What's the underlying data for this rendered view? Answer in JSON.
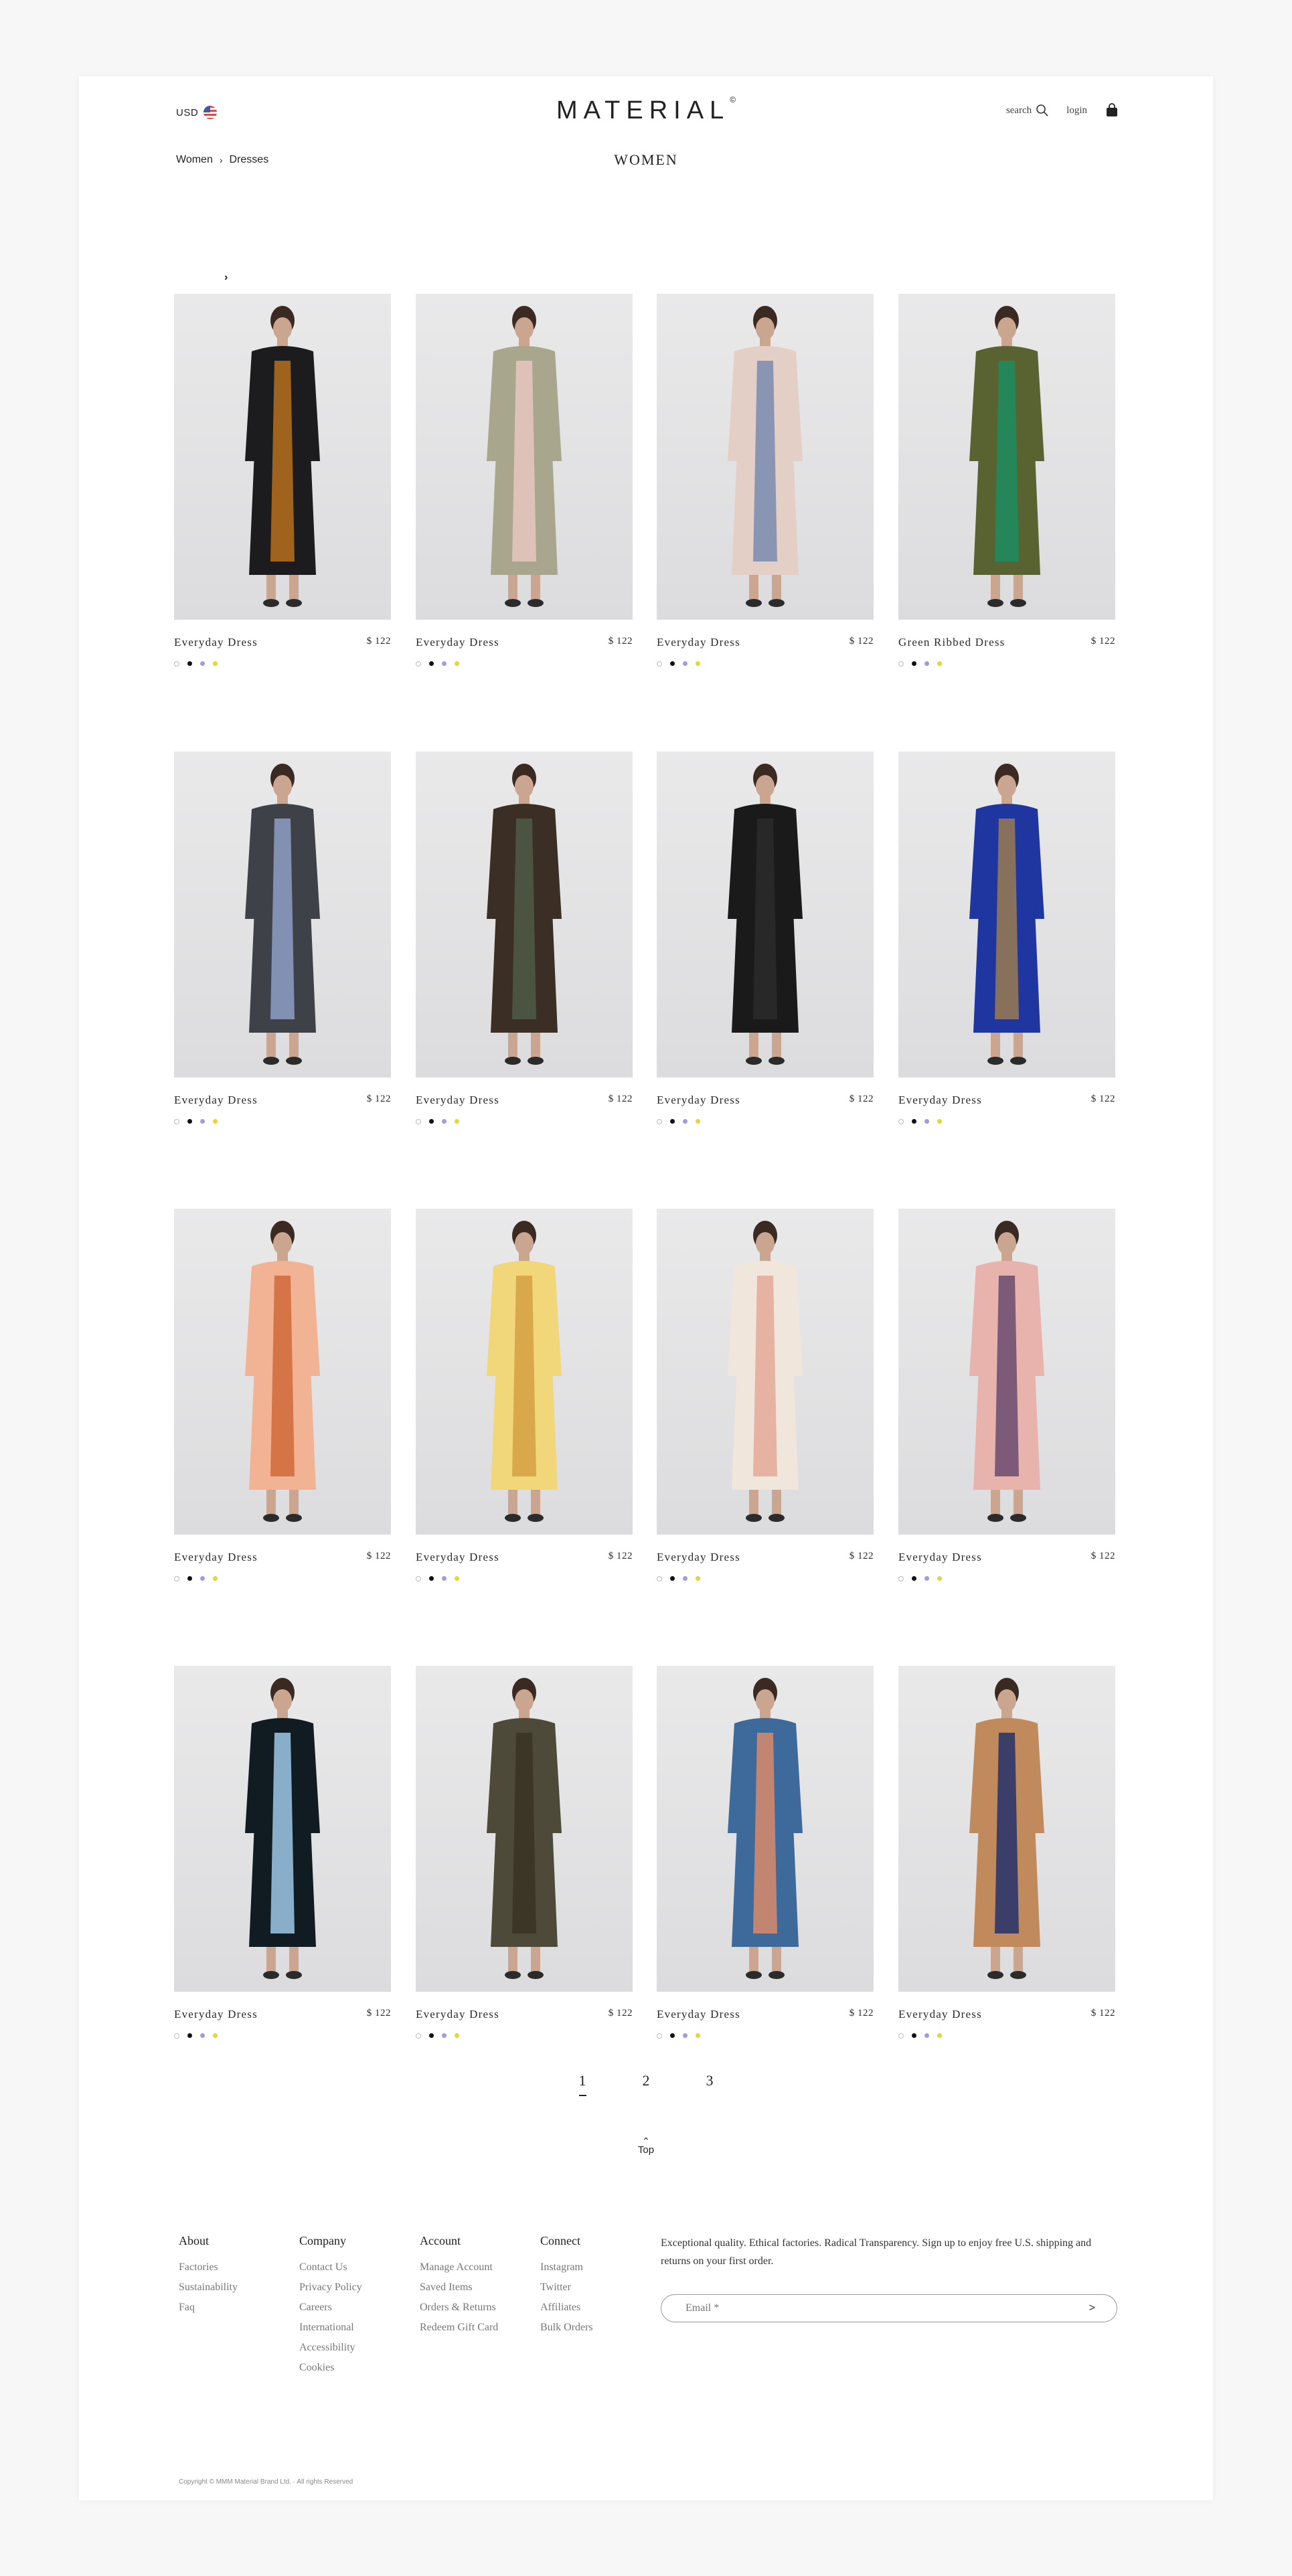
{
  "header": {
    "currency": "USD",
    "logo": "MATERIAL",
    "logo_mark": "©",
    "search_label": "search",
    "login_label": "login"
  },
  "breadcrumb": {
    "items": [
      "Women",
      "Dresses"
    ],
    "separator": "›"
  },
  "section_title": "WOMEN",
  "filter_chevron": "›",
  "products": [
    {
      "name": "Everyday Dress",
      "price": "$ 122",
      "outfit": "#1c1c1e",
      "accent": "#b7701d"
    },
    {
      "name": "Everyday Dress",
      "price": "$ 122",
      "outfit": "#a8a68c",
      "accent": "#e7c7c0"
    },
    {
      "name": "Everyday Dress",
      "price": "$ 122",
      "outfit": "#e4cfc7",
      "accent": "#7a8bb0"
    },
    {
      "name": "Green Ribbed Dress",
      "price": "$ 122",
      "outfit": "#596331",
      "accent": "#1c8c62"
    },
    {
      "name": "Everyday Dress",
      "price": "$ 122",
      "outfit": "#3e4148",
      "accent": "#8ea0c7"
    },
    {
      "name": "Everyday Dress",
      "price": "$ 122",
      "outfit": "#3b2f25",
      "accent": "#4f5a45"
    },
    {
      "name": "Everyday Dress",
      "price": "$ 122",
      "outfit": "#1a1a1a",
      "accent": "#2b2b2b"
    },
    {
      "name": "Everyday Dress",
      "price": "$ 122",
      "outfit": "#1f35a0",
      "accent": "#9a7a50"
    },
    {
      "name": "Everyday Dress",
      "price": "$ 122",
      "outfit": "#f2b394",
      "accent": "#d06a3a"
    },
    {
      "name": "Everyday Dress",
      "price": "$ 122",
      "outfit": "#f1d67a",
      "accent": "#d4a043"
    },
    {
      "name": "Everyday Dress",
      "price": "$ 122",
      "outfit": "#f1e6dc",
      "accent": "#e4a898"
    },
    {
      "name": "Everyday Dress",
      "price": "$ 122",
      "outfit": "#e8b3ad",
      "accent": "#6a4a6e"
    },
    {
      "name": "Everyday Dress",
      "price": "$ 122",
      "outfit": "#111c22",
      "accent": "#9fc8e8"
    },
    {
      "name": "Everyday Dress",
      "price": "$ 122",
      "outfit": "#4d4a3a",
      "accent": "#3a3225"
    },
    {
      "name": "Everyday Dress",
      "price": "$ 122",
      "outfit": "#3d6a9a",
      "accent": "#d98a6a"
    },
    {
      "name": "Everyday Dress",
      "price": "$ 122",
      "outfit": "#c08a5c",
      "accent": "#23306a"
    }
  ],
  "swatch_colors": [
    "white",
    "black",
    "purple",
    "yellow"
  ],
  "pagination": {
    "pages": [
      "1",
      "2",
      "3"
    ],
    "current": "1"
  },
  "top_label": "Top",
  "footer": {
    "about": {
      "title": "About",
      "links": [
        "Factories",
        "Sustainability",
        "Faq"
      ]
    },
    "company": {
      "title": "Company",
      "links": [
        "Contact Us",
        "Privacy Policy",
        "Careers",
        "International",
        "Accessibility",
        "Cookies"
      ]
    },
    "account": {
      "title": "Account",
      "links": [
        "Manage Account",
        "Saved Items",
        "Orders & Returns",
        "Redeem Gift Card"
      ]
    },
    "connect": {
      "title": "Connect",
      "links": [
        "Instagram",
        "Twitter",
        "Affiliates",
        "Bulk Orders"
      ]
    },
    "newsletter_text": "Exceptional quality. Ethical factories. Radical Transparency. Sign up to enjoy free U.S. shipping and returns on your first order.",
    "email_placeholder": "Email *",
    "submit_symbol": ">",
    "copyright": "Copyright © MMM Material Brand Ltd. · All rights Reserved"
  }
}
